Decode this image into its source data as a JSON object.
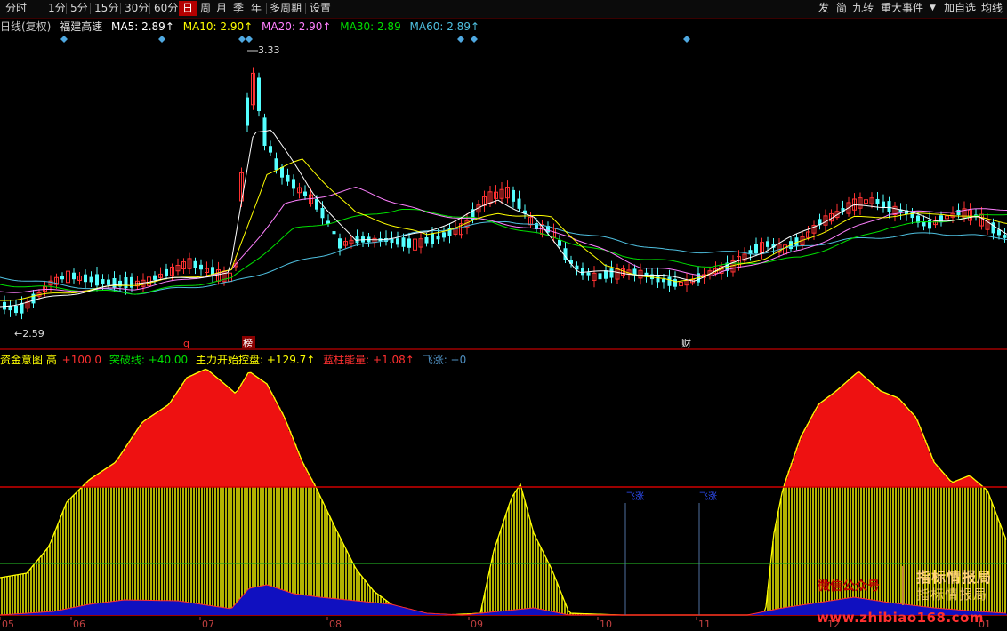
{
  "toolbar": {
    "periods": [
      "分时",
      "1分",
      "5分",
      "15分",
      "30分",
      "60分",
      "日",
      "周",
      "月",
      "季",
      "年",
      "多周期",
      "设置"
    ],
    "active": "日",
    "right": [
      "发",
      "简",
      "九转",
      "重大事件",
      "▼",
      "加自选",
      "均线"
    ]
  },
  "ma_line": {
    "prefix": "日线(复权)",
    "stock": "福建高速",
    "ma5": "MA5: 2.89↑",
    "ma10": "MA10: 2.90↑",
    "ma20": "MA20: 2.90↑",
    "ma30": "MA30: 2.89",
    "ma60": "MA60: 2.89↑"
  },
  "price_labels": {
    "high": "3.33",
    "low": "←2.59"
  },
  "markers": {
    "q": "q",
    "bang": "榜",
    "cai": "财"
  },
  "indicator_line": {
    "name": "资金意图 高",
    "high_val": "+100.0",
    "breakthrough": "突破线: +40.00",
    "control": "主力开始控盘: +129.7↑",
    "blue_energy": "蓝柱能量: +1.08↑",
    "feizhang": "飞涨: +0"
  },
  "feizhang_labels": [
    "飞涨",
    "飞涨"
  ],
  "x_axis": [
    "05",
    "06",
    "07",
    "08",
    "09",
    "10",
    "11",
    "12",
    "01"
  ],
  "watermark": {
    "wechat": "微信公众号",
    "brand1": "指标情报局",
    "brand2": "指标情报局",
    "website": "www.zhibiao168.com"
  },
  "colors": {
    "up": "#ff3232",
    "down": "#54ffff",
    "ma5": "#ffffff",
    "ma10": "#ffff00",
    "ma20": "#ff80ff",
    "ma30": "#00e000",
    "ma60": "#4fc0e0",
    "red_fill": "#ee1111",
    "yellow_fill": "#ffff00",
    "blue_fill": "#1010c0"
  },
  "chart_data": {
    "type": "candlestick+histogram",
    "price_range": [
      2.59,
      3.33
    ],
    "indicator_levels": {
      "high": 100,
      "breakthrough": 40
    }
  }
}
